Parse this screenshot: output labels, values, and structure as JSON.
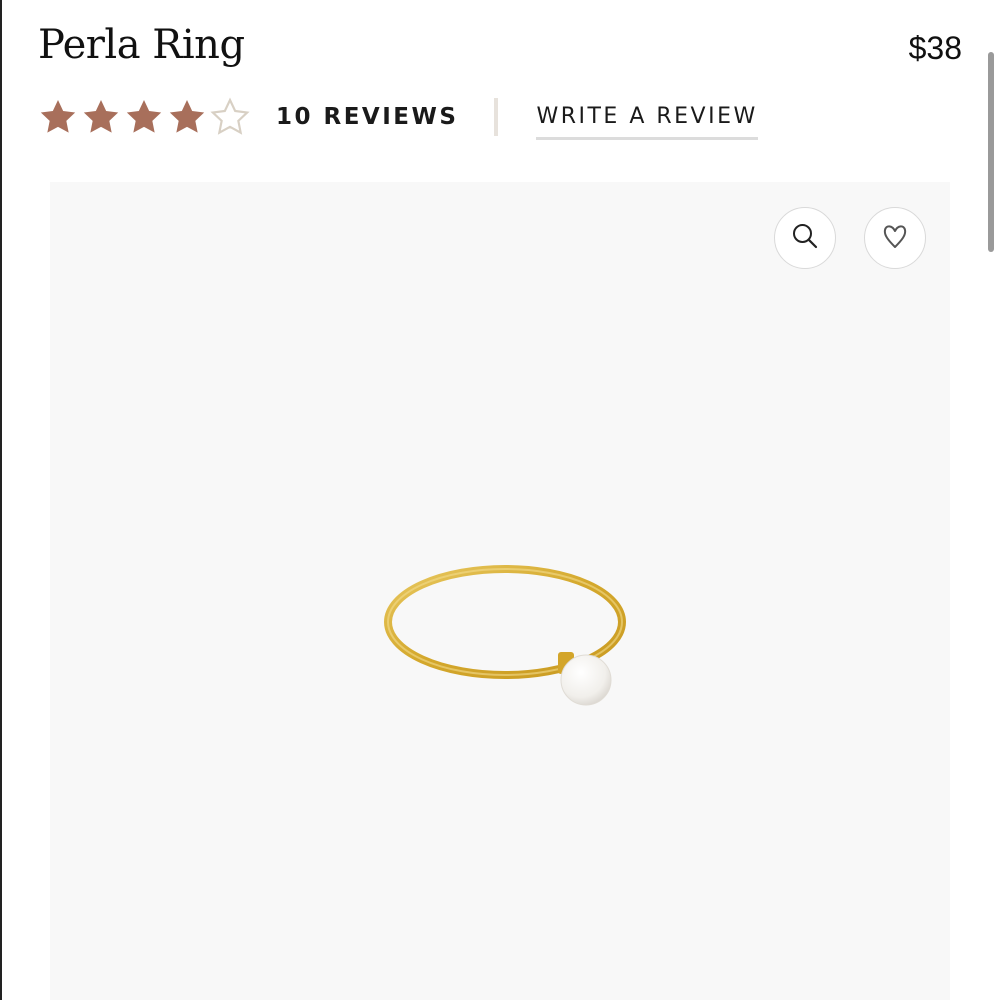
{
  "product": {
    "title": "Perla Ring",
    "price": "$38"
  },
  "rating": {
    "value": 4,
    "max": 5,
    "filled_color": "#a86f5b",
    "empty_color": "#d8d0c4",
    "reviews_label": "10 REVIEWS",
    "write_review_label": "WRITE A REVIEW"
  },
  "gallery": {
    "zoom_icon": "search-icon",
    "wishlist_icon": "heart-icon",
    "background_color": "#f8f8f8"
  }
}
